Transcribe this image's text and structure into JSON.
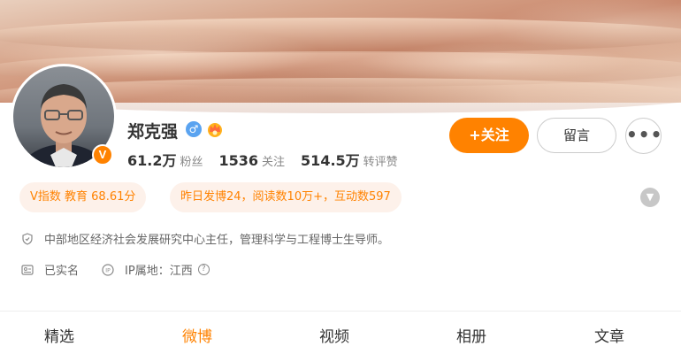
{
  "profile": {
    "name": "郑克强",
    "gender_icon": "male-icon",
    "verified_badge": "V",
    "stats": [
      {
        "value": "61.2万",
        "label": "粉丝"
      },
      {
        "value": "1536",
        "label": "关注"
      },
      {
        "value": "514.5万",
        "label": "转评赞"
      }
    ]
  },
  "actions": {
    "follow_label": "+关注",
    "message_label": "留言",
    "more_label": "•••"
  },
  "tags": {
    "vindex": "V指数 教育 68.61分",
    "activity": "昨日发博24，阅读数10万+，互动数597"
  },
  "info": {
    "bio": "中部地区经济社会发展研究中心主任，管理科学与工程博士生导师。",
    "verified": "已实名",
    "ip": "IP属地：江西"
  },
  "tabs": [
    "精选",
    "微博",
    "视频",
    "相册",
    "文章"
  ],
  "active_tab": "微博",
  "colors": {
    "accent": "#ff8200",
    "tag_bg": "#fdf1ea"
  }
}
